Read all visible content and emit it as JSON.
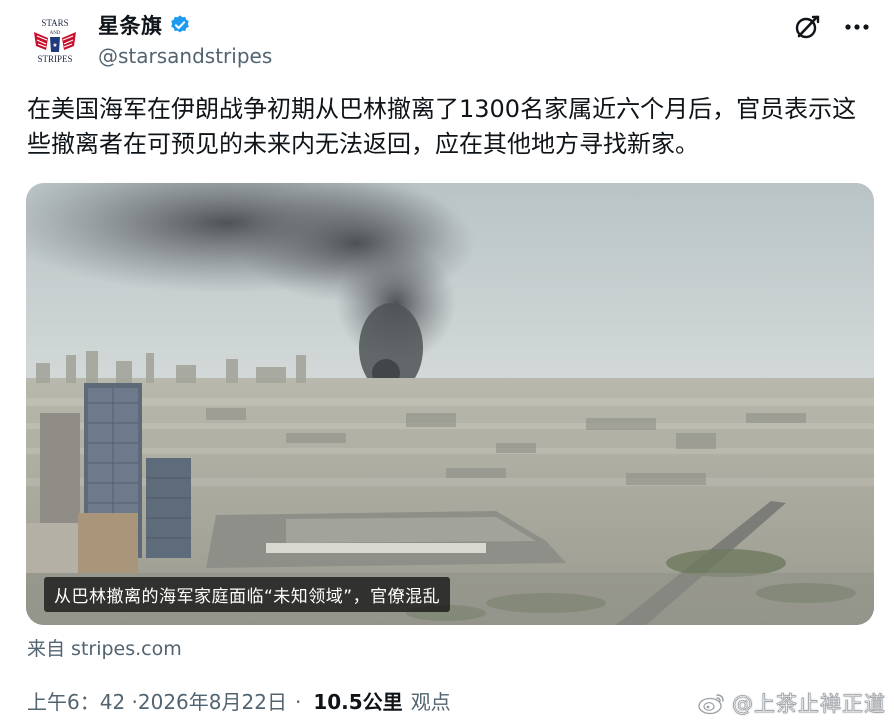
{
  "author": {
    "display_name": "星条旗",
    "handle": "@starsandstripes",
    "avatar_text": [
      "STARS",
      "AND",
      "STRIPES"
    ],
    "verified": true
  },
  "tweet": {
    "text": "在美国海军在伊朗战争初期从巴林撤离了1300名家属近六个月后，官员表示这些撤离者在可预见的未来内无法返回，应在其他地方寻找新家。"
  },
  "media": {
    "caption": "从巴林撤离的海军家庭面临“未知领域”，官僚混乱"
  },
  "source": "来自 stripes.com",
  "meta": {
    "timestamp": "上午6：42 ·2026年8月22日",
    "separator": "·",
    "views_count": "10.5公里",
    "views_label": "观点"
  },
  "watermark": {
    "text": "@上茶止禅正道"
  },
  "icons": {
    "grok": "grok-icon",
    "more": "more-icon",
    "verified": "verified-badge-icon",
    "weibo": "weibo-icon"
  },
  "colors": {
    "verified_blue": "#1d9bf0",
    "secondary_text": "#536471",
    "primary_text": "#0f1419"
  }
}
